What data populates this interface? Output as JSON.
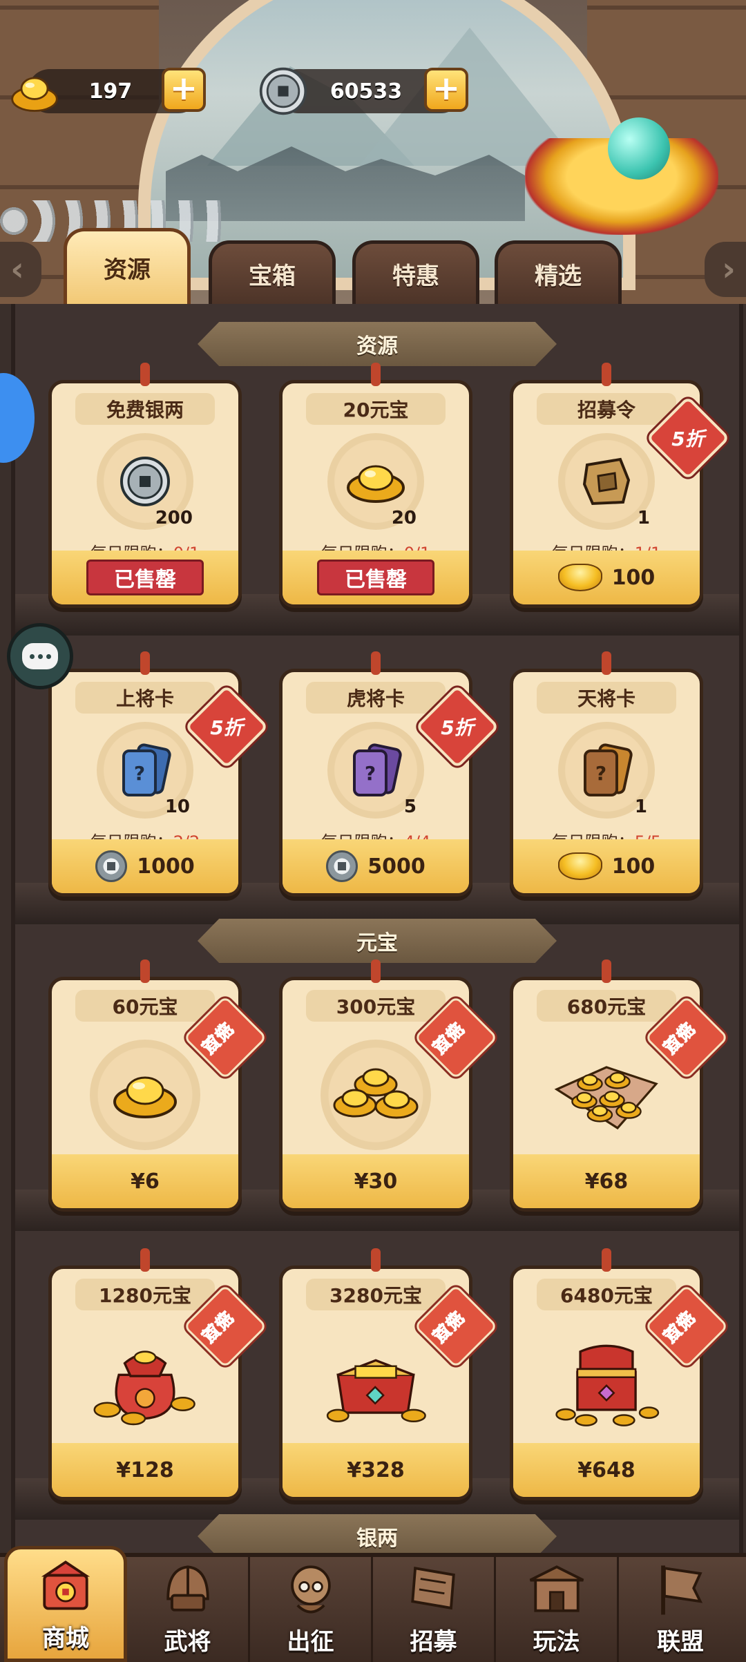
{
  "currency": {
    "gold": {
      "value": "197",
      "icon": "gold-ingot-icon"
    },
    "silver": {
      "value": "60533",
      "icon": "silver-coin-icon"
    },
    "plus_label": "+"
  },
  "tabs": [
    {
      "label": "资源",
      "active": true
    },
    {
      "label": "宝箱",
      "active": false
    },
    {
      "label": "特惠",
      "active": false
    },
    {
      "label": "精选",
      "active": false
    }
  ],
  "sections": {
    "resources": "资源",
    "ingots": "元宝",
    "silver": "银两"
  },
  "resource_items": [
    {
      "name": "免费银两",
      "icon": "silver-coin-icon",
      "qty": "200",
      "limit_label": "每日限购：",
      "limit": "0/1",
      "status": "已售罄"
    },
    {
      "name": "20元宝",
      "icon": "gold-ingot-icon",
      "qty": "20",
      "limit_label": "每日限购：",
      "limit": "0/1",
      "status": "已售罄"
    },
    {
      "name": "招募令",
      "icon": "recruit-token-icon",
      "qty": "1",
      "limit_label": "每日限购：",
      "limit": "1/1",
      "discount": "5折",
      "price_icon": "gold-ingot-icon",
      "price": "100"
    },
    {
      "name": "上将卡",
      "icon": "blue-card-icon",
      "qty": "10",
      "limit_label": "每日限购：",
      "limit": "2/2",
      "discount": "5折",
      "price_icon": "silver-coin-icon",
      "price": "1000"
    },
    {
      "name": "虎将卡",
      "icon": "purple-card-icon",
      "qty": "5",
      "limit_label": "每日限购：",
      "limit": "4/4",
      "discount": "5折",
      "price_icon": "silver-coin-icon",
      "price": "5000"
    },
    {
      "name": "天将卡",
      "icon": "orange-card-icon",
      "qty": "1",
      "limit_label": "每日限购：",
      "limit": "5/5",
      "price_icon": "gold-ingot-icon",
      "price": "100"
    }
  ],
  "ingot_items": [
    {
      "name": "60元宝",
      "badge": "首充双倍",
      "badge_l1": "首充",
      "badge_l2": "双倍",
      "price": "¥6",
      "icon": "single-ingot-icon"
    },
    {
      "name": "300元宝",
      "badge": "首充双倍",
      "badge_l1": "首充",
      "badge_l2": "双倍",
      "price": "¥30",
      "icon": "ingot-pile-icon"
    },
    {
      "name": "680元宝",
      "badge": "首充双倍",
      "badge_l1": "首充",
      "badge_l2": "双倍",
      "price": "¥68",
      "icon": "ingot-cloth-icon"
    },
    {
      "name": "1280元宝",
      "badge": "首充双倍",
      "badge_l1": "首充",
      "badge_l2": "双倍",
      "price": "¥128",
      "icon": "ingot-bag-icon"
    },
    {
      "name": "3280元宝",
      "badge": "首充双倍",
      "badge_l1": "首充",
      "badge_l2": "双倍",
      "price": "¥328",
      "icon": "ingot-box-icon"
    },
    {
      "name": "6480元宝",
      "badge": "首充双倍",
      "badge_l1": "首充",
      "badge_l2": "双倍",
      "price": "¥648",
      "icon": "treasure-chest-icon"
    }
  ],
  "bottom_nav": [
    {
      "label": "商城",
      "icon": "shop-icon",
      "active": true
    },
    {
      "label": "武将",
      "icon": "helmet-icon",
      "active": false
    },
    {
      "label": "出征",
      "icon": "general-icon",
      "active": false
    },
    {
      "label": "招募",
      "icon": "banner-icon",
      "active": false
    },
    {
      "label": "玩法",
      "icon": "gate-icon",
      "active": false
    },
    {
      "label": "联盟",
      "icon": "flag-icon",
      "active": false
    }
  ],
  "colors": {
    "accent_gold": "#f2c976",
    "sold_out_red": "#c8363e",
    "discount_red": "#d8443a",
    "limit_red": "#d1452f",
    "card_bg": "#f7e4c0"
  }
}
